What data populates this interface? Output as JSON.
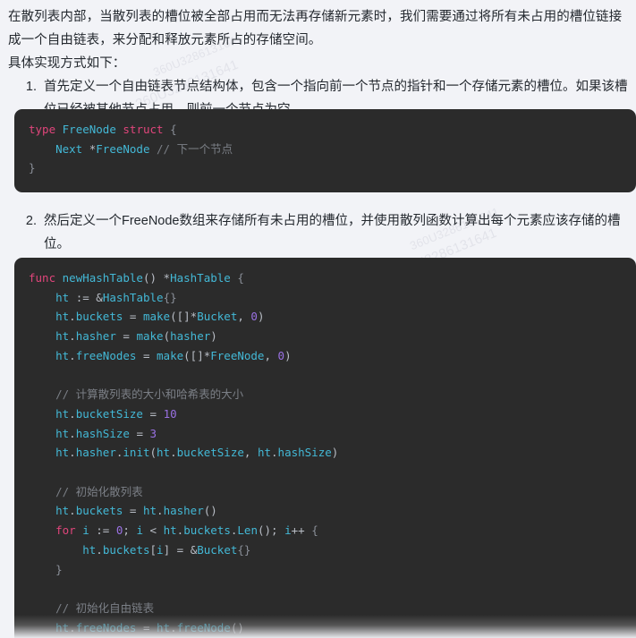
{
  "page": {
    "background_color": "#f2f3f7",
    "text_color": "#24292f"
  },
  "watermark": {
    "text": "360U3286131641",
    "color": "rgba(120,126,146,0.13)"
  },
  "intro": {
    "paragraph_1": "在散列表内部，当散列表的槽位被全部占用而无法再存储新元素时，我们需要通过将所有未占用的槽位链接成一个自由链表，来分配和释放元素所占的存储空间。",
    "paragraph_2": "具体实现方式如下："
  },
  "steps": [
    {
      "index": 1,
      "text": "首先定义一个自由链表节点结构体，包含一个指向前一个节点的指针和一个存储元素的槽位。如果该槽位已经被其他节点占用，则前一个节点为空。"
    },
    {
      "index": 2,
      "text": "然后定义一个FreeNode数组来存储所有未占用的槽位，并使用散列函数计算出每个元素应该存储的槽位。"
    }
  ],
  "code_blocks": [
    {
      "id": "code-block-1",
      "language": "go",
      "background_color": "#2b2b2b",
      "code": "type FreeNode struct {\n    Next *FreeNode // 下一个节点\n}"
    },
    {
      "id": "code-block-2",
      "language": "go",
      "background_color": "#2b2b2b",
      "truncated": true,
      "code": "func newHashTable() *HashTable {\n    ht := &HashTable{}\n    ht.buckets = make([]*Bucket, 0)\n    ht.hasher = make(hasher)\n    ht.freeNodes = make([]*FreeNode, 0)\n\n    // 计算散列表的大小和哈希表的大小\n    ht.bucketSize = 10\n    ht.hashSize = 3\n    ht.hasher.init(ht.bucketSize, ht.hashSize)\n\n    // 初始化散列表\n    ht.buckets = ht.hasher()\n    for i := 0; i < ht.buckets.Len(); i++ {\n        ht.buckets[i] = &Bucket{}\n    }\n\n    // 初始化自由链表\n    ht.freeNodes = ht.freeNode()"
    }
  ],
  "syntax_colors": {
    "keyword": "#e0457b",
    "identifier": "#43b8d6",
    "number": "#9a71e3",
    "comment": "#7b7f86",
    "punctuation": "#b9bec6",
    "brace": "#8a8f98"
  }
}
